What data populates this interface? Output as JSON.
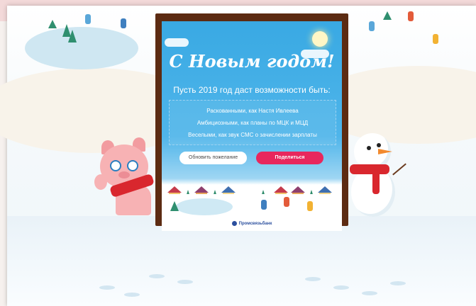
{
  "card": {
    "title": "С Новым годом!",
    "subtitle": "Пусть 2019 год даст возможности быть:",
    "wishes": [
      "Раскованными, как Настя Ивлеева",
      "Амбициозными, как планы по МЦК и МЦД",
      "Веселыми, как звук СМС о зачислении зарплаты"
    ],
    "refresh_button": "Обновить пожелание",
    "share_button": "Поделиться",
    "bank_name": "Промсвязьбанк"
  },
  "colors": {
    "sky": "#39a9e3",
    "share_button": "#e8275d",
    "frame": "#5c2b12",
    "bank": "#2b4f9e"
  },
  "icons": [
    "sun-icon",
    "bank-logo-icon"
  ]
}
